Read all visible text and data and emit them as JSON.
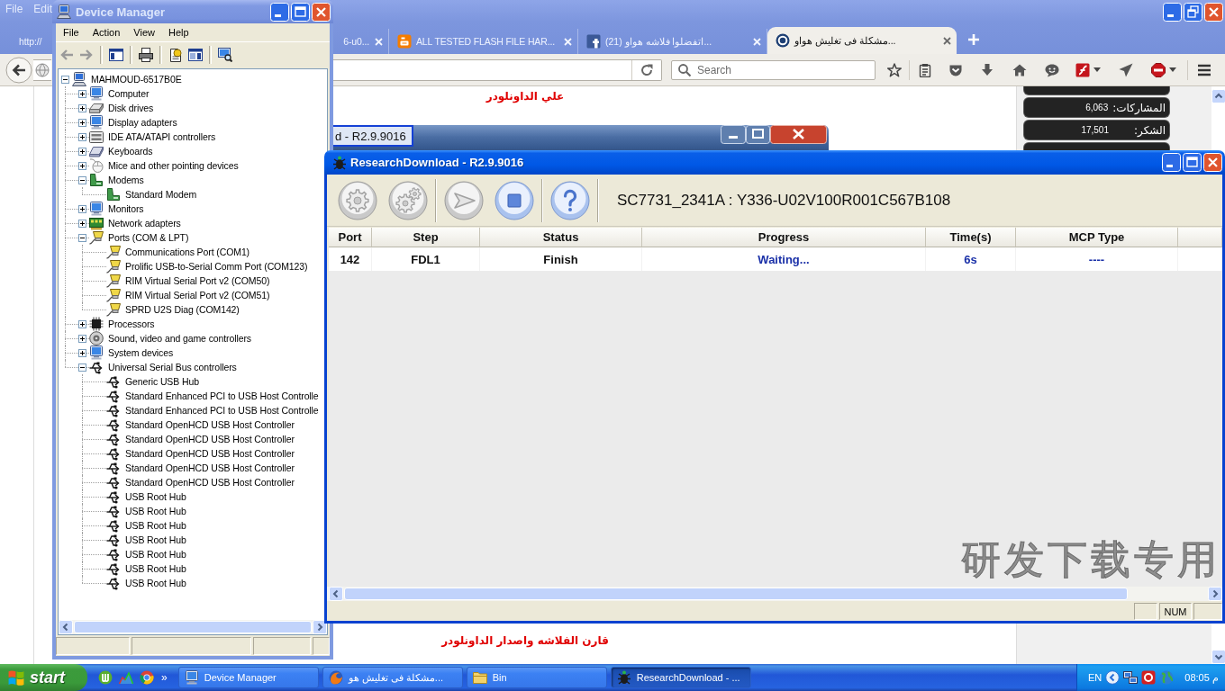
{
  "browser": {
    "menu": [
      "File",
      "Edit"
    ],
    "tabs": [
      {
        "label": "http://",
        "kind": "page",
        "selected": false
      },
      {
        "label": "6-u0...",
        "kind": "page",
        "selected": false
      },
      {
        "label": "ALL TESTED FLASH FILE HAR...",
        "kind": "blog",
        "selected": false
      },
      {
        "label": "(21) اتفضلوا فلاشه هواو...",
        "kind": "social",
        "selected": false
      },
      {
        "label": "مشكلة فى تغليش هواو...",
        "kind": "forum",
        "selected": true
      }
    ],
    "search": {
      "placeholder": "Search"
    },
    "page": {
      "notes": [
        "علي الداونلودر",
        "قارن الفلاشه واصدار الداونلودر"
      ],
      "stats": [
        {
          "label": "المشاركات:",
          "value": "6,063"
        },
        {
          "label": "الشكر:",
          "value": "17,501"
        }
      ]
    }
  },
  "background_window": {
    "title": "d - R2.9.9016"
  },
  "device_manager": {
    "title": "Device Manager",
    "active": false,
    "menu": [
      "File",
      "Action",
      "View",
      "Help"
    ],
    "tree": [
      {
        "label": "MAHMOUD-6517B0E",
        "kind": "host",
        "expanded": true,
        "children": [
          {
            "label": "Computer",
            "kind": "computer",
            "expanded": false
          },
          {
            "label": "Disk drives",
            "kind": "disk",
            "expanded": false
          },
          {
            "label": "Display adapters",
            "kind": "display",
            "expanded": false
          },
          {
            "label": "IDE ATA/ATAPI controllers",
            "kind": "ide",
            "expanded": false
          },
          {
            "label": "Keyboards",
            "kind": "keyboard",
            "expanded": false
          },
          {
            "label": "Mice and other pointing devices",
            "kind": "mouse",
            "expanded": false
          },
          {
            "label": "Modems",
            "kind": "modem",
            "expanded": true,
            "children": [
              {
                "label": "Standard Modem",
                "kind": "modem"
              }
            ]
          },
          {
            "label": "Monitors",
            "kind": "monitor",
            "expanded": false
          },
          {
            "label": "Network adapters",
            "kind": "network",
            "expanded": false
          },
          {
            "label": "Ports (COM & LPT)",
            "kind": "port",
            "expanded": true,
            "children": [
              {
                "label": "Communications Port (COM1)",
                "kind": "port"
              },
              {
                "label": "Prolific USB-to-Serial Comm Port (COM123)",
                "kind": "port"
              },
              {
                "label": "RIM Virtual Serial Port v2 (COM50)",
                "kind": "port"
              },
              {
                "label": "RIM Virtual Serial Port v2 (COM51)",
                "kind": "port"
              },
              {
                "label": "SPRD U2S Diag (COM142)",
                "kind": "port"
              }
            ]
          },
          {
            "label": "Processors",
            "kind": "processor",
            "expanded": false
          },
          {
            "label": "Sound, video and game controllers",
            "kind": "sound",
            "expanded": false
          },
          {
            "label": "System devices",
            "kind": "system",
            "expanded": false
          },
          {
            "label": "Universal Serial Bus controllers",
            "kind": "usb",
            "expanded": true,
            "children": [
              {
                "label": "Generic USB Hub",
                "kind": "usb"
              },
              {
                "label": "Standard Enhanced PCI to USB Host Controlle",
                "kind": "usb"
              },
              {
                "label": "Standard Enhanced PCI to USB Host Controlle",
                "kind": "usb"
              },
              {
                "label": "Standard OpenHCD USB Host Controller",
                "kind": "usb"
              },
              {
                "label": "Standard OpenHCD USB Host Controller",
                "kind": "usb"
              },
              {
                "label": "Standard OpenHCD USB Host Controller",
                "kind": "usb"
              },
              {
                "label": "Standard OpenHCD USB Host Controller",
                "kind": "usb"
              },
              {
                "label": "Standard OpenHCD USB Host Controller",
                "kind": "usb"
              },
              {
                "label": "USB Root Hub",
                "kind": "usb"
              },
              {
                "label": "USB Root Hub",
                "kind": "usb"
              },
              {
                "label": "USB Root Hub",
                "kind": "usb"
              },
              {
                "label": "USB Root Hub",
                "kind": "usb"
              },
              {
                "label": "USB Root Hub",
                "kind": "usb"
              },
              {
                "label": "USB Root Hub",
                "kind": "usb"
              },
              {
                "label": "USB Root Hub",
                "kind": "usb"
              }
            ]
          }
        ]
      }
    ]
  },
  "research_download": {
    "title": "ResearchDownload - R2.9.9016",
    "active": true,
    "toolbar": [
      [
        {
          "kind": "gear",
          "disabled": true
        },
        {
          "kind": "gears",
          "disabled": true
        }
      ],
      [
        {
          "kind": "start",
          "disabled": true
        },
        {
          "kind": "stop",
          "disabled": false
        }
      ],
      [
        {
          "kind": "help",
          "disabled": false
        }
      ]
    ],
    "firmware": "SC7731_2341A : Y336-U02V100R001C567B108",
    "table": {
      "columns": [
        "Port",
        "Step",
        "Status",
        "Progress",
        "Time(s)",
        "MCP Type"
      ],
      "rows": [
        [
          "142",
          "FDL1",
          "Finish",
          "Waiting...",
          "6s",
          "----"
        ]
      ]
    },
    "watermark": "研发下载专用",
    "status_bar": [
      "NUM"
    ]
  },
  "taskbar": {
    "start": "start",
    "more": "»",
    "items": [
      {
        "label": "Device Manager",
        "kind": "devices",
        "selected": false
      },
      {
        "label": "مشكلة فى تغليش هو...",
        "kind": "browser",
        "selected": false
      },
      {
        "label": "Bin",
        "kind": "folder",
        "selected": false
      },
      {
        "label": "ResearchDownload - ...",
        "kind": "tool",
        "selected": true
      }
    ],
    "language": "EN",
    "clock": "08:05 م"
  }
}
